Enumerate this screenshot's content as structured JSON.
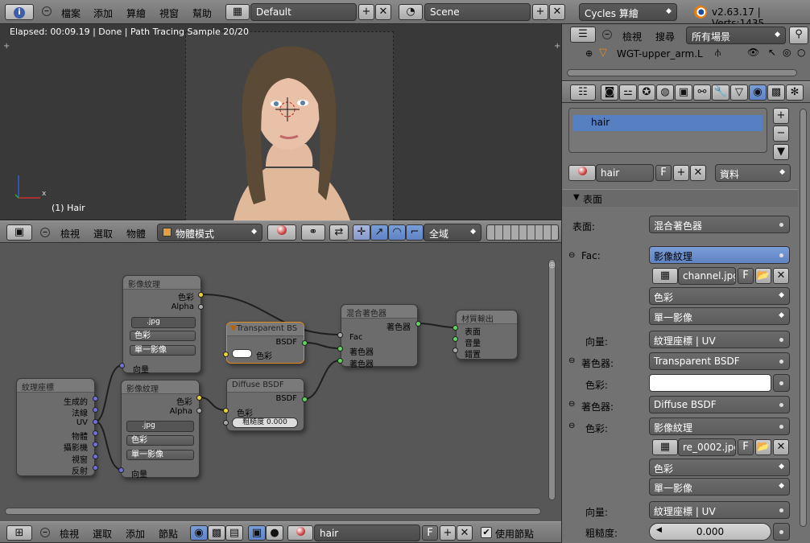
{
  "topbar": {
    "menus": [
      "檔案",
      "添加",
      "算繪",
      "視窗",
      "幫助"
    ],
    "layout": "Default",
    "scene": "Scene",
    "engine": "Cycles 算繪",
    "version": "v2.63.17 | Verts:1435"
  },
  "viewport": {
    "status": "Elapsed: 00:09.19 | Done | Path Tracing Sample 20/20",
    "object_label": "(1) Hair",
    "axis_x": "x",
    "header": {
      "menus": [
        "檢視",
        "選取",
        "物體"
      ],
      "mode": "物體模式",
      "orientation": "全域"
    }
  },
  "node_editor": {
    "nodes": {
      "img_top": {
        "title": "影像紋理",
        "out_color": "色彩",
        "out_alpha": "Alpha",
        "file": ".jpg",
        "f": "F",
        "sel1": "色彩",
        "sel2": "單一影像",
        "in_vector": "向量"
      },
      "img_bot": {
        "title": "影像紋理",
        "out_color": "色彩",
        "out_alpha": "Alpha",
        "file": ".jpg",
        "f": "F",
        "sel1": "色彩",
        "sel2": "單一影像",
        "in_vector": "向量"
      },
      "texcoord": {
        "title": "紋理座標",
        "outputs": [
          "生成的",
          "法線",
          "UV",
          "物體",
          "攝影機",
          "視窗",
          "反射"
        ]
      },
      "transparent": {
        "title": "Transparent BS",
        "out": "BSDF",
        "in_color": "色彩"
      },
      "diffuse": {
        "title": "Diffuse BSDF",
        "out": "BSDF",
        "in_color": "色彩",
        "roughness": "粗糙度 0.000"
      },
      "mix": {
        "title": "混合著色器",
        "out": "著色器",
        "in_fac": "Fac",
        "in1": "著色器",
        "in2": "著色器"
      },
      "output": {
        "title": "材質輸出",
        "in1": "表面",
        "in2": "音量",
        "in3": "錯置"
      }
    },
    "header": {
      "menus": [
        "檢視",
        "選取",
        "添加",
        "節點"
      ],
      "material": "hair",
      "f": "F",
      "use_nodes": "使用節點"
    }
  },
  "outliner": {
    "menus": [
      "檢視",
      "搜尋"
    ],
    "filter": "所有場景",
    "item": "WGT-upper_arm.L"
  },
  "properties": {
    "slot": "hair",
    "material_name": "hair",
    "f": "F",
    "link": "資料",
    "panel_title": "表面",
    "rows": {
      "surface_label": "表面:",
      "surface_value": "混合著色器",
      "fac_label": "Fac:",
      "fac_value": "影像紋理",
      "fac_file": "channel.jpg",
      "fac_sel1": "色彩",
      "fac_sel2": "單一影像",
      "vector1_label": "向量:",
      "vector1_value": "紋理座標 | UV",
      "shader1_label": "著色器:",
      "shader1_value": "Transparent BSDF",
      "color1_label": "色彩:",
      "shader2_label": "著色器:",
      "shader2_value": "Diffuse BSDF",
      "color2_label": "色彩:",
      "color2_value": "影像紋理",
      "color2_file": "re_0002.jpg",
      "color2_sel1": "色彩",
      "color2_sel2": "單一影像",
      "vector2_label": "向量:",
      "vector2_value": "紋理座標 | UV",
      "rough_label": "粗糙度:",
      "rough_value": "0.000"
    }
  },
  "colors": {
    "accent": "#5680c2",
    "socket_yellow": "#e8d43a",
    "socket_green": "#5fd45f",
    "socket_blue": "#7070d8"
  }
}
